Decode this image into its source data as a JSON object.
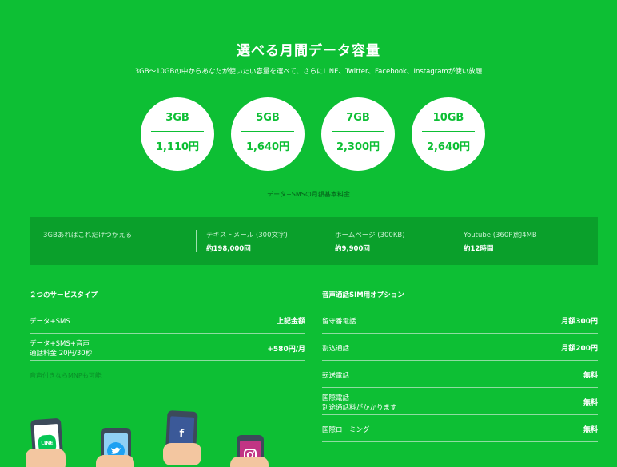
{
  "header": {
    "title": "選べる月間データ容量",
    "subtitle": "3GB～10GBの中からあなたが使いたい容量を選べて、さらにLINE、Twitter、Facebook、Instagramが使い放題"
  },
  "plans": [
    {
      "gb": "3GB",
      "price": "1,110円"
    },
    {
      "gb": "5GB",
      "price": "1,640円"
    },
    {
      "gb": "7GB",
      "price": "2,300円"
    },
    {
      "gb": "10GB",
      "price": "2,640円"
    }
  ],
  "plans_caption": "データ+SMSの月額基本料金",
  "usage": {
    "lead": "3GBあればこれだけつかえる",
    "items": [
      {
        "label": "テキストメール (300文字)",
        "value": "約198,000回"
      },
      {
        "label": "ホームページ (300KB)",
        "value": "約9,900回"
      },
      {
        "label": "Youtube (360P)約4MB",
        "value": "約12時間"
      }
    ]
  },
  "service_types": {
    "title": "２つのサービスタイプ",
    "rows": [
      {
        "label": "データ+SMS",
        "sublabel": "",
        "value": "上記金額"
      },
      {
        "label": "データ+SMS+音声",
        "sublabel": "通話料金 20円/30秒",
        "value": "+580円/月"
      }
    ],
    "note": "音声付きならMNPも可能"
  },
  "voice_options": {
    "title": "音声通話SIM用オプション",
    "rows": [
      {
        "label": "留守番電話",
        "sublabel": "",
        "value": "月額300円"
      },
      {
        "label": "割込通話",
        "sublabel": "",
        "value": "月額200円"
      },
      {
        "label": "転送電話",
        "sublabel": "",
        "value": "無料"
      },
      {
        "label": "国際電話",
        "sublabel": "別途通話料がかかります",
        "value": "無料"
      },
      {
        "label": "国際ローミング",
        "sublabel": "",
        "value": "無料"
      }
    ]
  },
  "apps": {
    "line": "LINE",
    "twitter": "twitter-icon",
    "facebook": "f",
    "instagram": "instagram-icon"
  },
  "colors": {
    "background": "#0dbf34",
    "band": "#0aa02b",
    "line": "#06c755",
    "twitter": "#1da1f2",
    "facebook": "#3b5998",
    "instagram": "#c13584"
  }
}
